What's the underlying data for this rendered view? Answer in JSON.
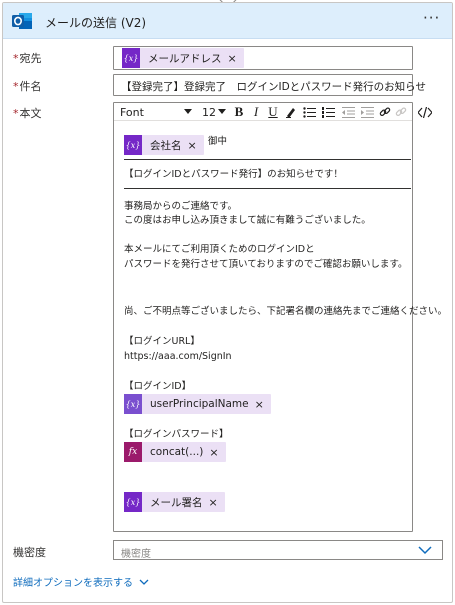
{
  "header": {
    "title": "メールの送信 (V2)",
    "more_label": "···",
    "icon": "outlook-icon"
  },
  "fields": {
    "to": {
      "label": "宛先",
      "required_mark": "*",
      "token": {
        "icon_text": "{x}",
        "label": "メールアドレス",
        "close": "×"
      }
    },
    "subject": {
      "label": "件名",
      "required_mark": "*",
      "value": "【登録完了】登録完了　ログインIDとパスワード発行のお知らせ"
    },
    "body": {
      "label": "本文",
      "required_mark": "*",
      "toolbar": {
        "font": "Font",
        "size": "12",
        "bold": "B",
        "italic": "I",
        "underline": "U"
      },
      "company_token": {
        "icon_text": "{x}",
        "label": "会社名",
        "close": "×"
      },
      "salutation": "御中",
      "lines": {
        "notice": "【ログインIDとパスワード発行】のお知らせです！",
        "l1": "事務局からのご連絡です。",
        "l2": "この度はお申し込み頂きまして誠に有難うございました。",
        "l3": "本メールにてご利用頂くためのログインIDと",
        "l4": "パスワードを発行させて頂いておりますのでご確認お願いします。",
        "l5": "尚、ご不明点等ございましたら、下記署名欄の連絡先までご連絡ください。",
        "l6": "【ログインURL】",
        "l7": "https://aaa.com/SignIn",
        "l8": "【ログインID】",
        "l9": "【ログインパスワード】"
      },
      "upn_token": {
        "icon_text": "{x}",
        "label": "userPrincipalName",
        "close": "×"
      },
      "concat_token": {
        "icon_text": "fx",
        "label": "concat(...)",
        "close": "×"
      },
      "signature_token": {
        "icon_text": "{x}",
        "label": "メール署名",
        "close": "×"
      }
    },
    "sensitivity": {
      "label": "機密度",
      "placeholder": "機密度"
    }
  },
  "advanced_link": "詳細オプションを表示する",
  "colors": {
    "header_bg": "#ddeefc",
    "variable_token": "#7528c7",
    "expression_token": "#9b1a6b",
    "token_bg": "#ebe0f5",
    "link": "#0f6cbd",
    "required": "#a4262c"
  }
}
